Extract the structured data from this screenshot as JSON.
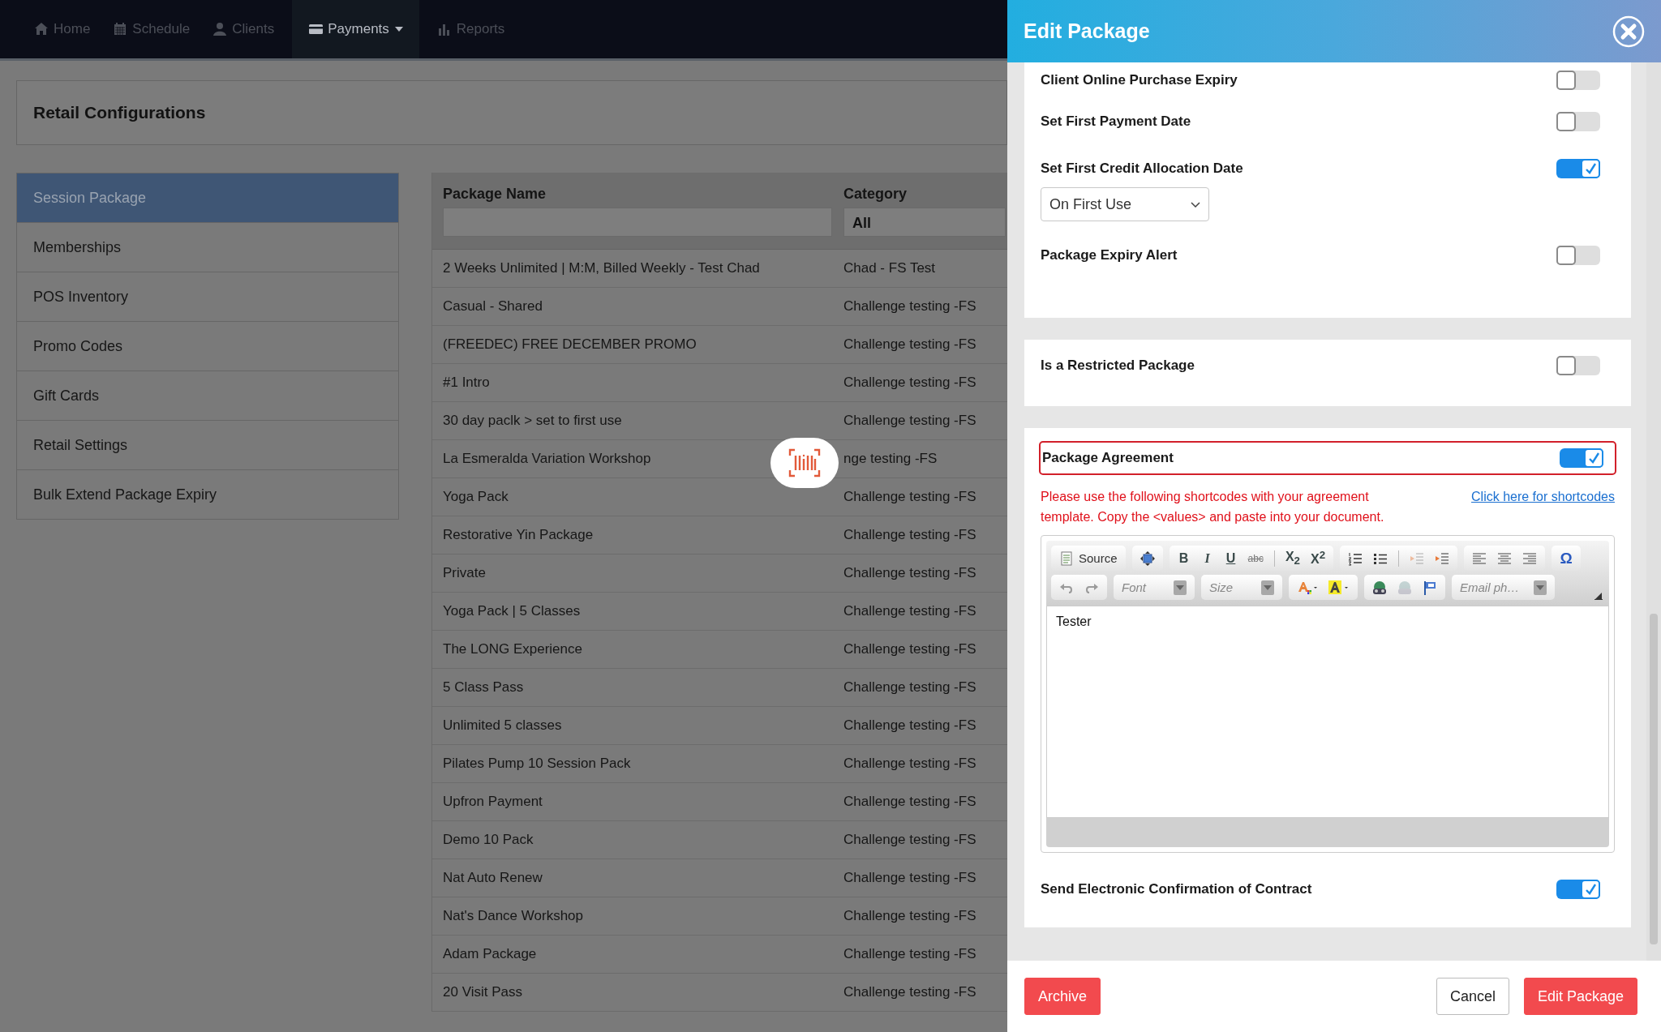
{
  "nav": {
    "items": [
      {
        "label": "Home",
        "kind": "home",
        "selected": false,
        "dropdown": false
      },
      {
        "label": "Schedule",
        "kind": "calendar",
        "selected": false,
        "dropdown": false
      },
      {
        "label": "Clients",
        "kind": "person",
        "selected": false,
        "dropdown": false
      },
      {
        "label": "Payments",
        "kind": "card",
        "selected": true,
        "dropdown": true
      },
      {
        "label": "Reports",
        "kind": "chart",
        "selected": false,
        "dropdown": false
      }
    ]
  },
  "page_title": "Retail Configurations",
  "sidebar": {
    "items": [
      {
        "label": "Session Package",
        "selected": true
      },
      {
        "label": "Memberships",
        "selected": false
      },
      {
        "label": "POS Inventory",
        "selected": false
      },
      {
        "label": "Promo Codes",
        "selected": false
      },
      {
        "label": "Gift Cards",
        "selected": false
      },
      {
        "label": "Retail Settings",
        "selected": false
      },
      {
        "label": "Bulk Extend Package Expiry",
        "selected": false
      }
    ]
  },
  "table": {
    "columns": [
      {
        "label": "Package Name",
        "filter": {
          "kind": "text"
        }
      },
      {
        "label": "Category",
        "filter": {
          "kind": "select",
          "value": "All"
        }
      }
    ],
    "rows": [
      [
        "2 Weeks Unlimited | M:M, Billed Weekly - Test Chad",
        "Chad - FS Test"
      ],
      [
        "Casual - Shared",
        "Challenge testing -FS"
      ],
      [
        "(FREEDEC) FREE DECEMBER PROMO",
        "Challenge testing -FS"
      ],
      [
        "#1 Intro",
        "Challenge testing -FS"
      ],
      [
        "30 day paclk > set to first use",
        "Challenge testing -FS"
      ],
      [
        "La Esmeralda Variation Workshop",
        "nge testing -FS"
      ],
      [
        "Yoga Pack",
        "Challenge testing -FS"
      ],
      [
        "Restorative Yin Package",
        "Challenge testing -FS"
      ],
      [
        "Private",
        "Challenge testing -FS"
      ],
      [
        "Yoga Pack | 5 Classes",
        "Challenge testing -FS"
      ],
      [
        "The LONG Experience",
        "Challenge testing -FS"
      ],
      [
        "5 Class Pass",
        "Challenge testing -FS"
      ],
      [
        "Unlimited 5 classes",
        "Challenge testing -FS"
      ],
      [
        "Pilates Pump 10 Session Pack",
        "Challenge testing -FS"
      ],
      [
        "Upfron Payment",
        "Challenge testing -FS"
      ],
      [
        "Demo 10 Pack",
        "Challenge testing -FS"
      ],
      [
        "Nat Auto Renew",
        "Challenge testing -FS"
      ],
      [
        "Nat's Dance Workshop",
        "Challenge testing -FS"
      ],
      [
        "Adam Package",
        "Challenge testing -FS"
      ],
      [
        "20 Visit Pass",
        "Challenge testing -FS"
      ]
    ]
  },
  "scan_button": {
    "kind": "barcode"
  },
  "panel": {
    "title": "Edit Package",
    "cards": [
      {
        "rows": [
          {
            "kind": "toggle",
            "label": "Client Online Purchase Expiry",
            "on": false,
            "highlighted": false
          },
          {
            "kind": "toggle",
            "label": "Set First Payment Date",
            "on": false,
            "highlighted": false
          },
          {
            "kind": "toggle",
            "label": "Set First Credit Allocation Date",
            "on": true,
            "highlighted": false
          },
          {
            "kind": "select",
            "value": "On First Use"
          },
          {
            "kind": "toggle",
            "label": "Package Expiry Alert",
            "on": false,
            "highlighted": false
          }
        ]
      },
      {
        "rows": [
          {
            "kind": "toggle",
            "label": "Is a Restricted Package",
            "on": false,
            "highlighted": false
          }
        ]
      },
      {
        "rows": [
          {
            "kind": "toggle",
            "label": "Package Agreement",
            "on": true,
            "highlighted": true
          },
          {
            "kind": "notice",
            "text": "Please use the following shortcodes with your agreement template. Copy the <values> and paste into your document.",
            "link": "Click here for shortcodes"
          },
          {
            "kind": "editor",
            "content": "Tester",
            "toolbar": [
              [
                [
                  {
                    "kind": "source",
                    "label": "Source",
                    "disabled": false
                  }
                ],
                [
                  {
                    "kind": "maximize",
                    "disabled": false
                  }
                ],
                [
                  {
                    "kind": "bold",
                    "label": "B",
                    "disabled": false
                  },
                  {
                    "kind": "italic",
                    "label": "I",
                    "disabled": false
                  },
                  {
                    "kind": "underline",
                    "label": "U",
                    "disabled": false
                  },
                  {
                    "kind": "strike",
                    "label": "abc",
                    "disabled": false
                  },
                  {
                    "kind": "separator"
                  },
                  {
                    "kind": "subscript",
                    "label": "X$_{2}$",
                    "disabled": false
                  },
                  {
                    "kind": "superscript",
                    "label": "X$^{2}$",
                    "disabled": false
                  }
                ],
                [
                  {
                    "kind": "numbered-list",
                    "disabled": false
                  },
                  {
                    "kind": "bulleted-list",
                    "disabled": false
                  },
                  {
                    "kind": "separator"
                  },
                  {
                    "kind": "outdent",
                    "disabled": true
                  },
                  {
                    "kind": "indent",
                    "disabled": false
                  }
                ],
                [
                  {
                    "kind": "align-left",
                    "disabled": false
                  },
                  {
                    "kind": "align-center",
                    "disabled": false
                  },
                  {
                    "kind": "align-right",
                    "disabled": false
                  }
                ],
                [
                  {
                    "kind": "special-char",
                    "label": "Ω",
                    "disabled": false
                  }
                ]
              ],
              [
                [
                  {
                    "kind": "undo",
                    "disabled": true
                  },
                  {
                    "kind": "redo",
                    "disabled": true
                  }
                ],
                [
                  {
                    "kind": "combo",
                    "label": "Font"
                  }
                ],
                [
                  {
                    "kind": "combo",
                    "label": "Size"
                  }
                ],
                [
                  {
                    "kind": "text-color",
                    "disabled": false
                  },
                  {
                    "kind": "bg-color",
                    "disabled": false
                  }
                ],
                [
                  {
                    "kind": "link",
                    "disabled": false
                  },
                  {
                    "kind": "unlink",
                    "disabled": true
                  },
                  {
                    "kind": "anchor",
                    "disabled": false
                  }
                ],
                [
                  {
                    "kind": "combo",
                    "label": "Email ph…"
                  }
                ]
              ]
            ]
          },
          {
            "kind": "toggle",
            "label": "Send Electronic Confirmation of Contract",
            "on": true,
            "highlighted": false
          }
        ]
      }
    ],
    "footer": {
      "left": [
        {
          "label": "Archive",
          "kind": "danger"
        }
      ],
      "right": [
        {
          "label": "Cancel",
          "kind": "default"
        },
        {
          "label": "Edit Package",
          "kind": "danger"
        }
      ]
    }
  }
}
